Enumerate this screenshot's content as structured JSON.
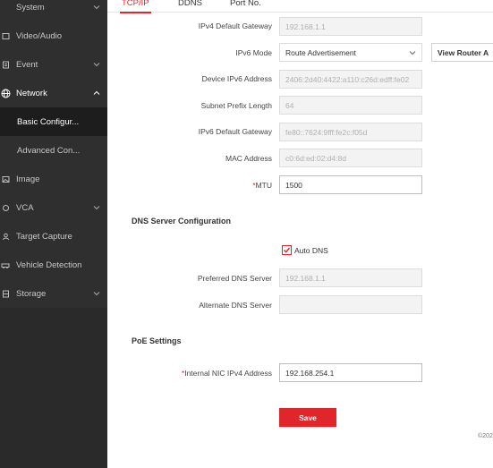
{
  "sidebar": {
    "items": [
      {
        "label": "System",
        "icon": "system-icon"
      },
      {
        "label": "Video/Audio",
        "icon": "video-audio-icon"
      },
      {
        "label": "Event",
        "icon": "event-icon"
      },
      {
        "label": "Network",
        "icon": "network-globe-icon"
      },
      {
        "label": "Basic Configur...",
        "icon": ""
      },
      {
        "label": "Advanced Con...",
        "icon": ""
      },
      {
        "label": "Image",
        "icon": "image-icon"
      },
      {
        "label": "VCA",
        "icon": "vca-icon"
      },
      {
        "label": "Target Capture",
        "icon": "target-capture-icon"
      },
      {
        "label": "Vehicle Detection",
        "icon": "vehicle-detection-icon"
      },
      {
        "label": "Storage",
        "icon": "storage-icon"
      }
    ]
  },
  "tabs": [
    {
      "label": "TCP/IP",
      "active": true
    },
    {
      "label": "DDNS",
      "active": false
    },
    {
      "label": "Port No.",
      "active": false
    }
  ],
  "form": {
    "ipv4_gateway": {
      "label": "IPv4 Default Gateway",
      "value": "192.168.1.1"
    },
    "ipv6_mode": {
      "label": "IPv6 Mode",
      "value": "Route Advertisement"
    },
    "view_router_button": "View Router A",
    "device_ipv6": {
      "label": "Device IPv6 Address",
      "value": "2406:2d40:4422:a110:c26d:edff:fe02"
    },
    "subnet_prefix": {
      "label": "Subnet Prefix Length",
      "value": "64"
    },
    "ipv6_gateway": {
      "label": "IPv6 Default Gateway",
      "value": "fe80::7624:9fff:fe2c:f05d"
    },
    "mac": {
      "label": "MAC Address",
      "value": "c0:6d:ed:02:d4:8d"
    },
    "mtu": {
      "required": "*",
      "label": "MTU",
      "value": "1500"
    }
  },
  "dns": {
    "section_title": "DNS Server Configuration",
    "auto_dns_label": "Auto DNS",
    "auto_dns_checked": true,
    "preferred": {
      "label": "Preferred DNS Server",
      "value": "192.168.1.1"
    },
    "alternate": {
      "label": "Alternate DNS Server",
      "value": ""
    }
  },
  "poe": {
    "section_title": "PoE Settings",
    "internal_nic": {
      "required": "*",
      "label": "Internal NIC IPv4 Address",
      "value": "192.168.254.1"
    }
  },
  "save_label": "Save",
  "footer": "©202",
  "colors": {
    "accent": "#e0262b",
    "sidebar_bg": "#2f2f2f"
  }
}
